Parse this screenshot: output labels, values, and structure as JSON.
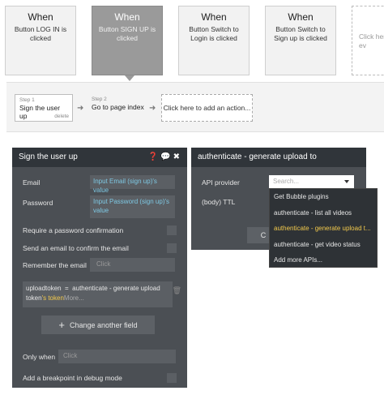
{
  "events": [
    {
      "when": "When",
      "desc": "Button LOG IN is clicked"
    },
    {
      "when": "When",
      "desc": "Button SIGN UP is clicked"
    },
    {
      "when": "When",
      "desc": "Button Switch to Login is clicked"
    },
    {
      "when": "When",
      "desc": "Button Switch to Sign up is clicked"
    },
    {
      "when": "",
      "desc": "Click her ev"
    }
  ],
  "steps": [
    {
      "num": "Step 1",
      "title": "Sign the user up",
      "delete": "delete"
    },
    {
      "num": "Step 2",
      "title": "Go to page index"
    }
  ],
  "add_action": "Click here to add an action...",
  "left_panel": {
    "title": "Sign the user up",
    "email_label": "Email",
    "email_value": "Input Email (sign up)'s value",
    "password_label": "Password",
    "password_value": "Input Password (sign up)'s value",
    "require_confirm": "Require a password confirmation",
    "send_email": "Send an email to confirm the email",
    "remember_email": "Remember the email",
    "remember_placeholder": "Click",
    "field_name": "uploadtoken",
    "field_eq": "=",
    "field_value_a": "authenticate - generate upload",
    "field_value_b": "token",
    "field_value_hl": "'s token",
    "field_more": "More...",
    "change_field": "Change another field",
    "only_when": "Only when",
    "only_when_placeholder": "Click",
    "breakpoint": "Add a breakpoint in debug mode"
  },
  "right_panel": {
    "title": "authenticate - generate upload to",
    "api_provider_label": "API provider",
    "select_placeholder": "Search...",
    "ttl_label": "(body) TTL",
    "ok_label": "C"
  },
  "dropdown": [
    "Get Bubble plugins",
    "authenticate - list all videos",
    "authenticate - generate upload t...",
    "authenticate - get video status",
    "Add more APIs..."
  ]
}
